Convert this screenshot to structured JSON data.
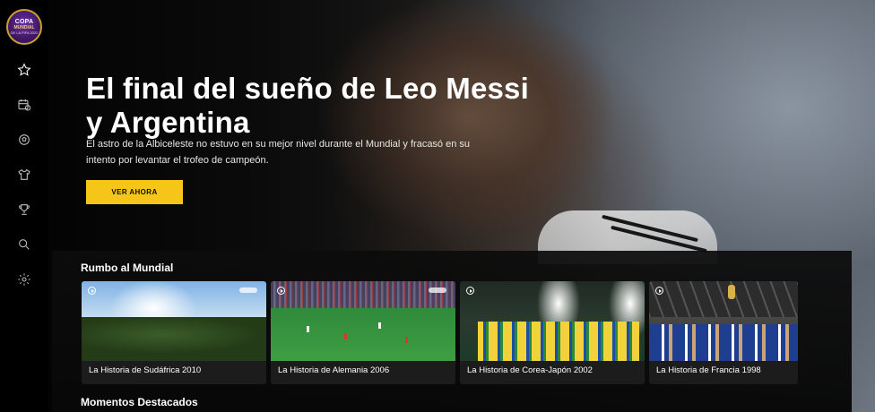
{
  "logo": {
    "line1": "COPA",
    "line2": "MUNDIAL",
    "line3": "DE LA FIFA 2022"
  },
  "sidebar": {
    "items": [
      {
        "icon": "star-icon"
      },
      {
        "icon": "calendar-icon"
      },
      {
        "icon": "ball-icon"
      },
      {
        "icon": "shirt-icon"
      },
      {
        "icon": "trophy-icon"
      },
      {
        "icon": "search-icon"
      },
      {
        "icon": "settings-icon"
      }
    ]
  },
  "hero": {
    "title_line1": "El final del sueño de Leo Messi",
    "title_line2": "y Argentina",
    "description": "El astro de la Albiceleste no estuvo en su mejor nivel durante el Mundial y fracasó en su intento por levantar el trofeo de campeón.",
    "cta_label": "VER AHORA",
    "cta_color": "#f5c518"
  },
  "sections": [
    {
      "title": "Rumbo al Mundial",
      "cards": [
        {
          "label": "La Historia de Sudáfrica 2010"
        },
        {
          "label": "La Historia de Alemania 2006"
        },
        {
          "label": "La Historia de Corea-Japón 2002"
        },
        {
          "label": "La Historia de Francia 1998"
        }
      ]
    },
    {
      "title": "Momentos Destacados"
    }
  ]
}
